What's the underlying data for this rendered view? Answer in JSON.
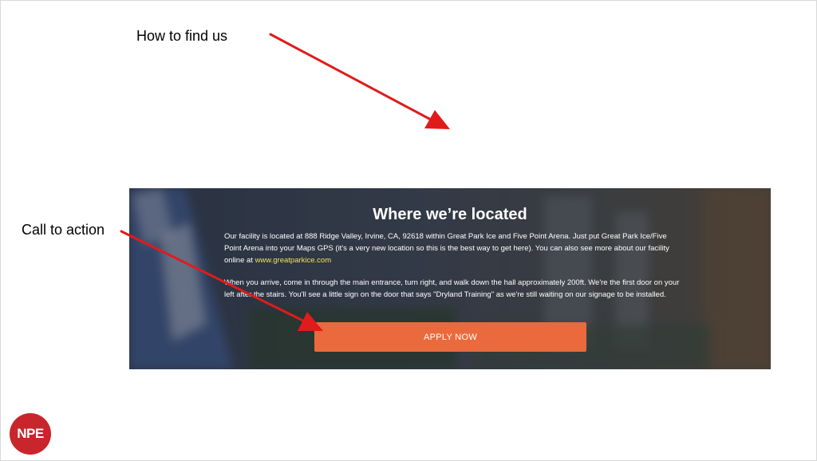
{
  "annotations": {
    "find_us": "How to find us",
    "call_to_action": "Call to action"
  },
  "arrow_color": "#e01b1b",
  "location_section": {
    "title": "Where we’re located",
    "paragraph1_text": "Our facility is located at 888 Ridge Valley, Irvine, CA, 92618 within Great Park Ice and Five Point Arena. Just put Great Park Ice/Five Point Arena into your Maps GPS (it's a very new location so this is the best way to get here). You can also see more about our facility online at ",
    "paragraph1_link": "www.greatparkice.com",
    "paragraph2_text": "When you arrive, come in through the main entrance, turn right, and walk down the hall approximately 200ft. We're the first door on your left after the stairs. You'll see a little sign on the door that says \"Dryland Training\" as we're still waiting on our signage to be installed.",
    "button_label": "APPLY NOW",
    "button_color": "#ea6a3d",
    "link_color": "#f4e05a"
  },
  "logo": {
    "text": "NPE",
    "color": "#c8252d"
  }
}
